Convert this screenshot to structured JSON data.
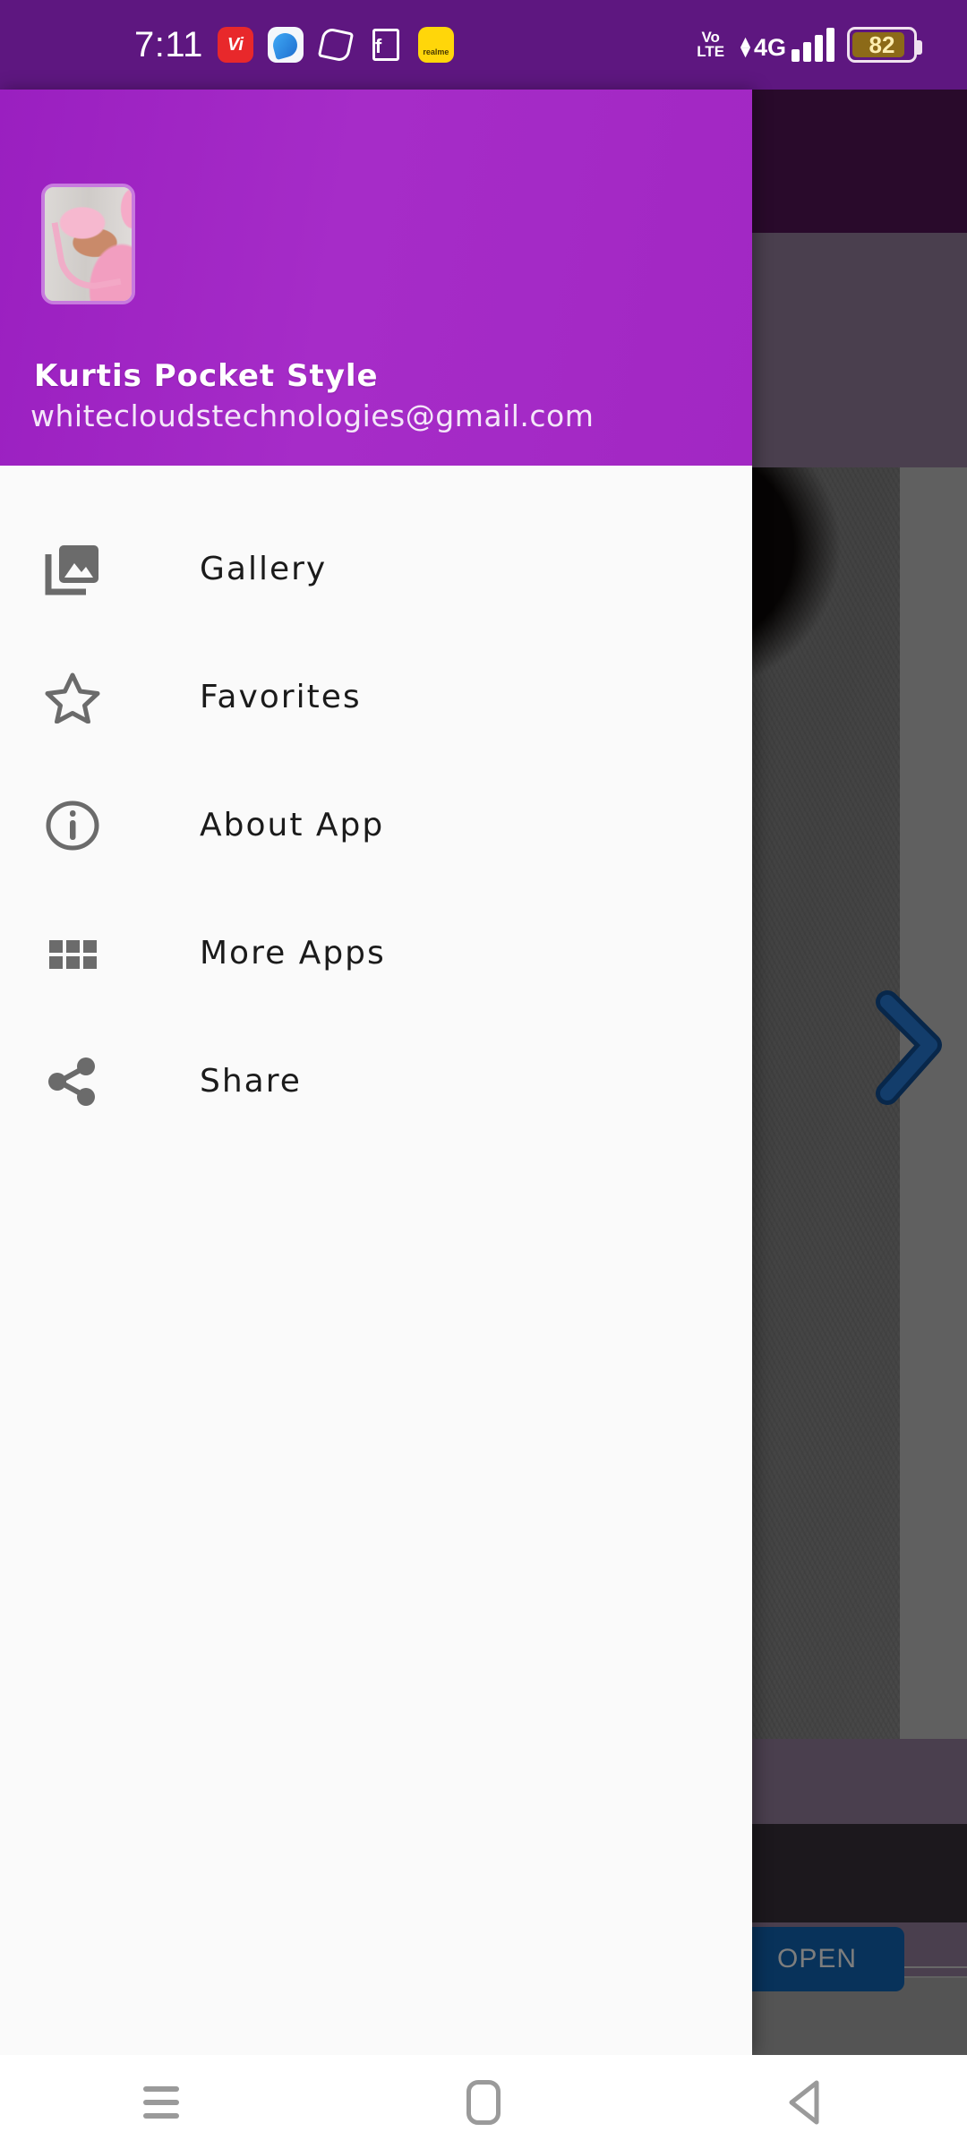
{
  "status_bar": {
    "clock": "7:11",
    "notification_icons": [
      {
        "name": "vi-app-icon",
        "label": "Vi"
      },
      {
        "name": "browser-app-icon",
        "label": ""
      },
      {
        "name": "white-outline-app-icon",
        "label": ""
      },
      {
        "name": "flipkart-app-icon",
        "label": "f"
      },
      {
        "name": "realme-store-app-icon",
        "label": "realme"
      }
    ],
    "volte_line1": "Vo",
    "volte_line2": "LTE",
    "network_type": "4G",
    "data_arrows": "⇕",
    "signal_bars": 4,
    "battery_percent": "82",
    "background_color": "#5E1780"
  },
  "drawer": {
    "header": {
      "app_name": "Kurtis Pocket Style",
      "email": "whitecloudstechnologies@gmail.com",
      "avatar_name": "app-avatar-thumbnail",
      "background_color": "#A32BC4"
    },
    "items": [
      {
        "label": "Gallery",
        "icon": "photo-library-icon"
      },
      {
        "label": "Favorites",
        "icon": "star-outline-icon"
      },
      {
        "label": "About App",
        "icon": "info-circle-icon"
      },
      {
        "label": "More Apps",
        "icon": "grid-apps-icon"
      },
      {
        "label": "Share",
        "icon": "share-nodes-icon"
      }
    ],
    "background_color": "#FAFAFA"
  },
  "background_app": {
    "overflow_menu": "overflow-menu-icon",
    "next_arrow": "chevron-right-next-icon",
    "ad_open_button": "OPEN",
    "ad_button_color": "#0D4B85",
    "appbar_color": "#3D1040"
  },
  "nav_bar": {
    "recents": "recents-icon",
    "home": "home-icon",
    "back": "back-icon"
  }
}
